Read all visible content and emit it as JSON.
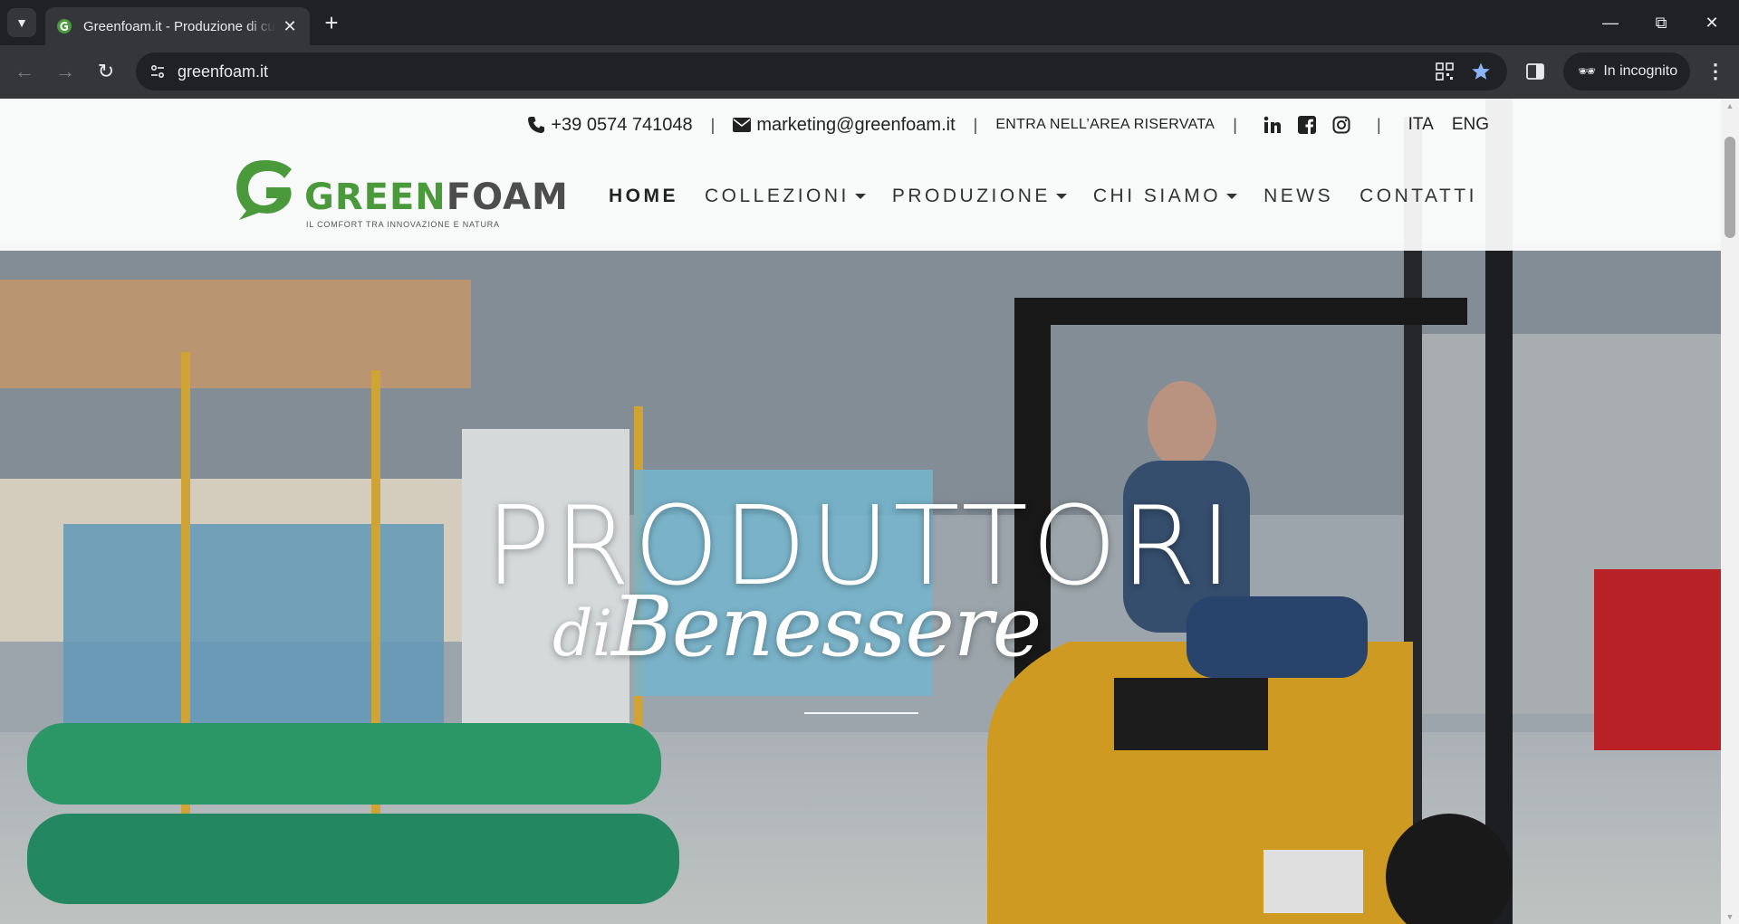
{
  "browser": {
    "tab_title": "Greenfoam.it - Produzione di cu",
    "url": "greenfoam.it",
    "incognito_label": "In incognito",
    "icons": [
      "tab-search-icon",
      "favicon-icon",
      "close-icon",
      "plus-icon",
      "back-icon",
      "forward-icon",
      "reload-icon",
      "site-info-icon",
      "qr-code-icon",
      "star-icon",
      "side-panel-icon",
      "incognito-icon",
      "more-vert-icon",
      "minimize-icon",
      "restore-icon",
      "window-close-icon"
    ]
  },
  "topbar": {
    "phone": "+39 0574 741048",
    "email": "marketing@greenfoam.it",
    "reserved_area": "ENTRA NELL’AREA RISERVATA",
    "separator": "|",
    "languages": [
      "ITA",
      "ENG"
    ]
  },
  "logo": {
    "word_green": "GREEN",
    "word_dark": "FOAM",
    "tagline": "IL COMFORT TRA INNOVAZIONE E NATURA"
  },
  "nav": {
    "items": [
      {
        "label": "HOME",
        "active": true
      },
      {
        "label": "COLLEZIONI",
        "dropdown": true
      },
      {
        "label": "PRODUZIONE",
        "dropdown": true
      },
      {
        "label": "CHI SIAMO",
        "dropdown": true
      },
      {
        "label": "NEWS"
      },
      {
        "label": "CONTATTI"
      }
    ]
  },
  "hero": {
    "title": "PRODUTTORI",
    "sub_di": "di",
    "sub_main": "Benessere"
  },
  "colors": {
    "brand_green": "#4a9a3c",
    "chrome_dark": "#202124",
    "chrome_toolbar": "#35363a",
    "star_blue": "#8ab4f8"
  }
}
